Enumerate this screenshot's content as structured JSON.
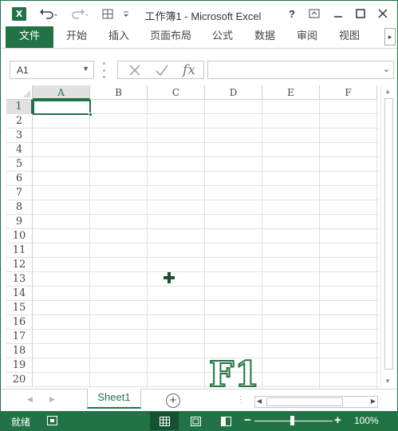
{
  "app": {
    "title": "工作簿1 - Microsoft Excel",
    "logo_text": "X"
  },
  "window_controls": {
    "help": "?",
    "minimize": "—",
    "maximize": "☐",
    "close": "✕"
  },
  "ribbon": {
    "tabs": [
      {
        "label": "文件",
        "active": true
      },
      {
        "label": "开始"
      },
      {
        "label": "插入"
      },
      {
        "label": "页面布局"
      },
      {
        "label": "公式"
      },
      {
        "label": "数据"
      },
      {
        "label": "审阅"
      },
      {
        "label": "视图"
      }
    ]
  },
  "name_box": {
    "value": "A1"
  },
  "formula_bar": {
    "value": "",
    "fx_label": "fx"
  },
  "grid": {
    "columns": [
      "A",
      "B",
      "C",
      "D",
      "E",
      "F"
    ],
    "rows": [
      "1",
      "2",
      "3",
      "4",
      "5",
      "6",
      "7",
      "8",
      "9",
      "10",
      "11",
      "12",
      "13",
      "14",
      "15",
      "16",
      "17",
      "18",
      "19",
      "20"
    ],
    "active_cell": "A1",
    "selected_column": "A",
    "selected_row": "1"
  },
  "overlay": {
    "key_label": "F1"
  },
  "sheets": {
    "tabs": [
      {
        "label": "Sheet1",
        "active": true
      }
    ]
  },
  "status": {
    "ready_text": "就绪",
    "zoom": "100%"
  },
  "colors": {
    "accent": "#217346",
    "grid_line": "#e1e1e1"
  }
}
